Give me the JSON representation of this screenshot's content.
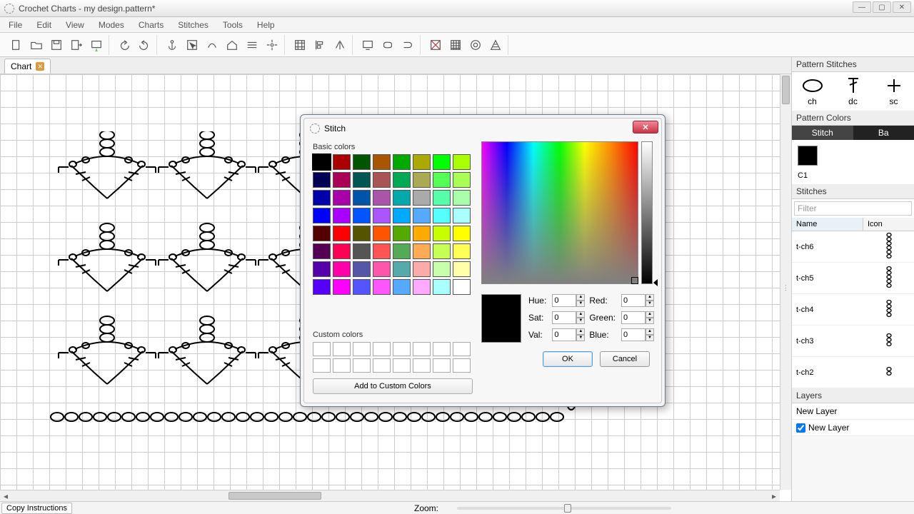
{
  "window": {
    "title": "Crochet Charts - my design.pattern*"
  },
  "menu": {
    "file": "File",
    "edit": "Edit",
    "view": "View",
    "modes": "Modes",
    "charts": "Charts",
    "stitches": "Stitches",
    "tools": "Tools",
    "help": "Help"
  },
  "tab": {
    "label": "Chart"
  },
  "statusbar": {
    "copy": "Copy Instructions",
    "zoom": "Zoom:"
  },
  "rightpane": {
    "pattern_stitches_title": "Pattern Stitches",
    "ps": {
      "ch": "ch",
      "dc": "dc",
      "sc": "sc"
    },
    "pattern_colors_title": "Pattern Colors",
    "color_tabs": {
      "stitch": "Stitch",
      "ba": "Ba"
    },
    "swatch_label": "C1",
    "stitches_title": "Stitches",
    "filter_placeholder": "Filter",
    "headers": {
      "name": "Name",
      "icon": "Icon"
    },
    "rows": [
      "t-ch6",
      "t-ch5",
      "t-ch4",
      "t-ch3",
      "t-ch2"
    ],
    "layers_title": "Layers",
    "layer_name": "New Layer",
    "layer_checked": "New Layer"
  },
  "dialog": {
    "title": "Stitch",
    "basic_label": "Basic colors",
    "custom_label": "Custom colors",
    "add_custom": "Add to Custom Colors",
    "hue": "Hue:",
    "sat": "Sat:",
    "val": "Val:",
    "red": "Red:",
    "green": "Green:",
    "blue": "Blue:",
    "hue_v": "0",
    "sat_v": "0",
    "val_v": "0",
    "red_v": "0",
    "green_v": "0",
    "blue_v": "0",
    "ok": "OK",
    "cancel": "Cancel",
    "basic_colors": [
      "#000000",
      "#aa0000",
      "#005500",
      "#aa5500",
      "#00aa00",
      "#aaaa00",
      "#00ff00",
      "#aaff00",
      "#000055",
      "#aa0055",
      "#005555",
      "#aa5555",
      "#00aa55",
      "#aaaa55",
      "#55ff55",
      "#aaff55",
      "#0000aa",
      "#aa00aa",
      "#0055aa",
      "#aa55aa",
      "#00aaaa",
      "#aaaaaa",
      "#55ffaa",
      "#aaffaa",
      "#0000ff",
      "#aa00ff",
      "#0055ff",
      "#aa55ff",
      "#00aaff",
      "#55aaff",
      "#55ffff",
      "#aaffff",
      "#550000",
      "#ff0000",
      "#555500",
      "#ff5500",
      "#55aa00",
      "#ffaa00",
      "#c8ff00",
      "#ffff00",
      "#550055",
      "#ff0055",
      "#555555",
      "#ff5555",
      "#55aa55",
      "#ffaa55",
      "#c8ff55",
      "#ffff55",
      "#5500aa",
      "#ff00aa",
      "#5555aa",
      "#ff55aa",
      "#55aaaa",
      "#ffaaaa",
      "#c8ffaa",
      "#ffffaa",
      "#5500ff",
      "#ff00ff",
      "#5555ff",
      "#ff55ff",
      "#55aaff",
      "#ffaaff",
      "#aaffff",
      "#ffffff"
    ]
  }
}
